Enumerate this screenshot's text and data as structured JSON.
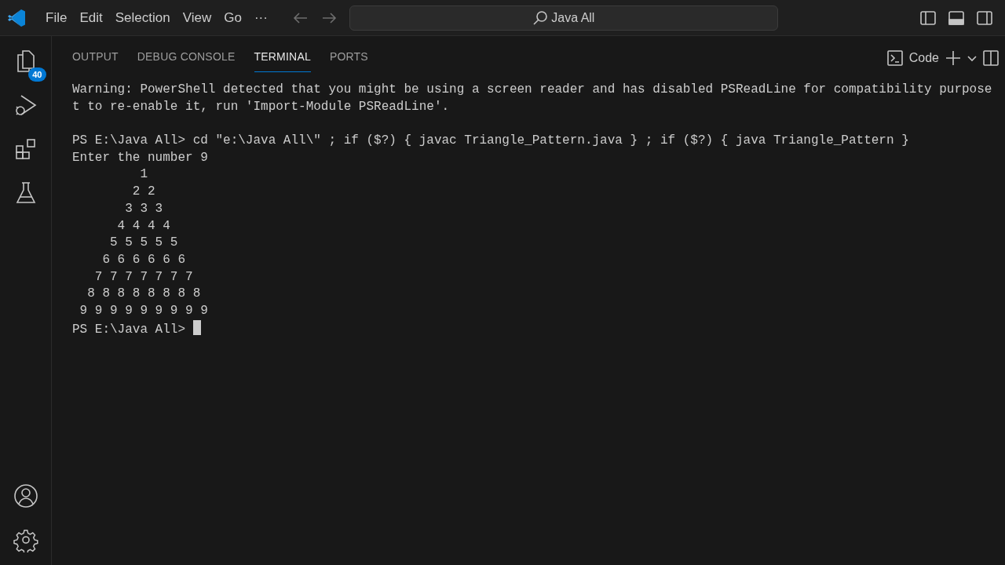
{
  "menu": [
    "File",
    "Edit",
    "Selection",
    "View",
    "Go",
    "···"
  ],
  "search": {
    "value": "Java All"
  },
  "activity_bar": {
    "top": [
      {
        "kind": "files",
        "badge": "40"
      },
      {
        "kind": "debug"
      },
      {
        "kind": "extensions"
      },
      {
        "kind": "testing"
      }
    ],
    "bottom": [
      {
        "kind": "account"
      },
      {
        "kind": "settings"
      }
    ]
  },
  "panel": {
    "tabs": [
      {
        "label": "OUTPUT",
        "selected": false
      },
      {
        "label": "DEBUG CONSOLE",
        "selected": false
      },
      {
        "label": "TERMINAL",
        "selected": true
      },
      {
        "label": "PORTS",
        "selected": false
      }
    ],
    "terminal_name": "Code"
  },
  "terminal": {
    "blocks": [
      [
        "Warning: PowerShell detected that you might be using a screen reader and has disabled PSReadLine for compatibility purpose",
        "t to re-enable it, run 'Import-Module PSReadLine'."
      ],
      [
        "PS E:\\Java All> cd \"e:\\Java All\\\" ; if ($?) { javac Triangle_Pattern.java } ; if ($?) { java Triangle_Pattern }",
        "Enter the number 9",
        "         1",
        "        2 2",
        "       3 3 3",
        "      4 4 4 4",
        "     5 5 5 5 5",
        "    6 6 6 6 6 6",
        "   7 7 7 7 7 7 7",
        "  8 8 8 8 8 8 8 8",
        " 9 9 9 9 9 9 9 9 9",
        "PS E:\\Java All> "
      ]
    ],
    "cursor": true
  }
}
